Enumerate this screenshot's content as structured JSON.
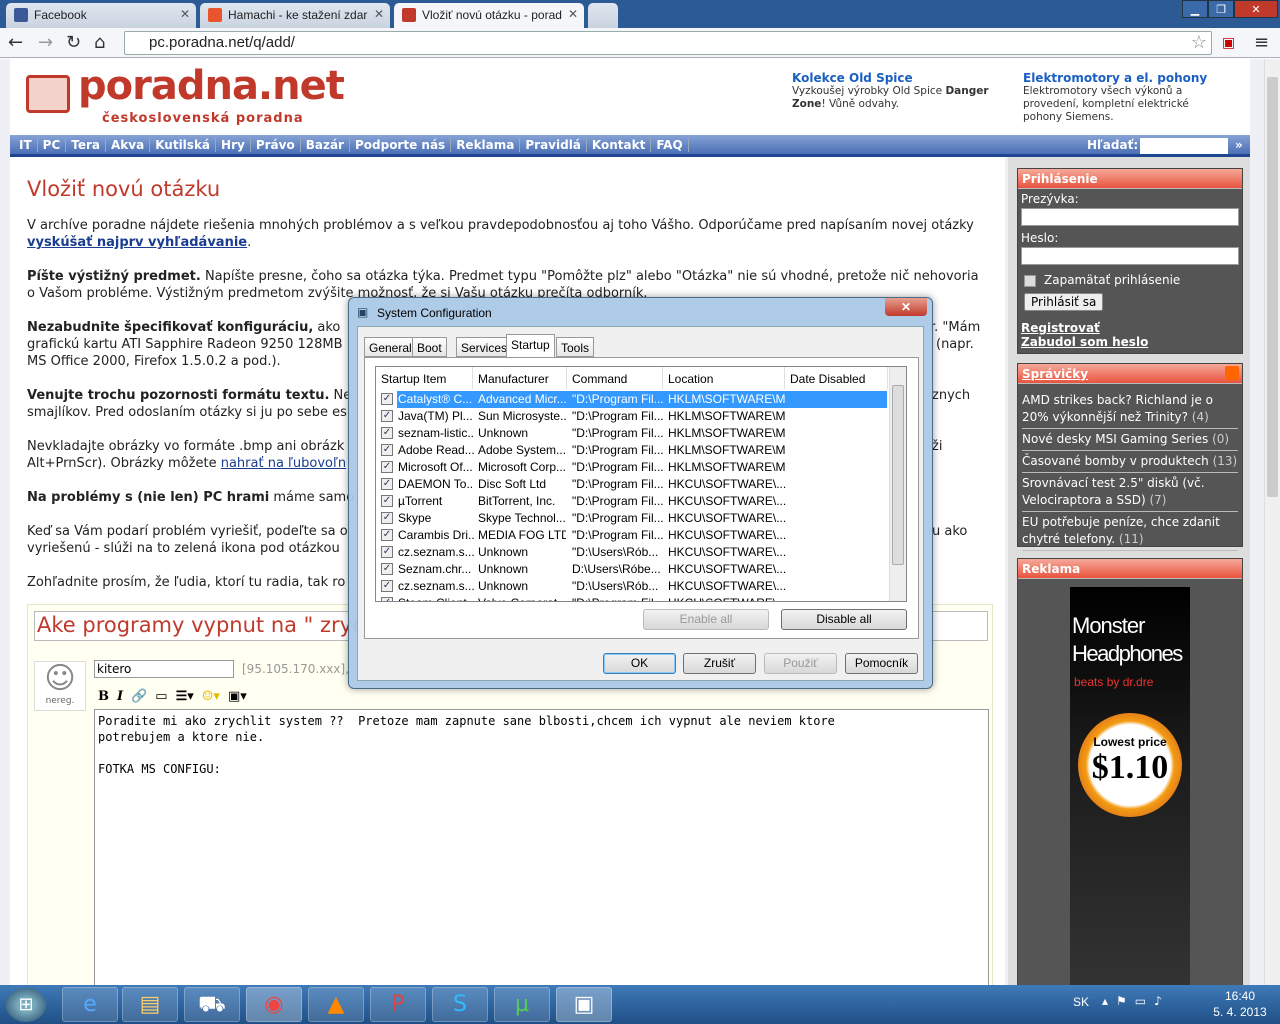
{
  "browser": {
    "tabs": [
      {
        "title": "Facebook",
        "color": "#3b5998"
      },
      {
        "title": "Hamachi - ke stažení zdar",
        "color": "#e8542c"
      },
      {
        "title": "Vložiť novú otázku - porad",
        "color": "#c0392b"
      }
    ],
    "url": "pc.poradna.net/q/add/",
    "window": {
      "minimize": "▁",
      "maximize": "❐",
      "close": "✕"
    }
  },
  "header": {
    "logo": "poradna.net",
    "tagline": "československá poradna",
    "ads": [
      {
        "title": "Kolekce Old Spice",
        "text1": "Vyzkoušej výrobky Old Spice ",
        "bold1": "Danger Zone",
        "text2": "! Vůně odvahy."
      },
      {
        "title": "Elektromotory a el. pohony",
        "text": "Elektromotory všech výkonů a provedení, kompletní elektrické pohony Siemens."
      }
    ]
  },
  "nav": {
    "items": [
      "IT",
      "PC",
      "Tera",
      "Akva",
      "Kutilská",
      "Hry",
      "Právo",
      "Bazár",
      "Podporte nás",
      "Reklama",
      "Pravidlá",
      "Kontakt",
      "FAQ"
    ],
    "search_label": "Hľadať:",
    "go": "»"
  },
  "main": {
    "title": "Vložiť novú otázku",
    "p1a": "V archíve poradne nájdete riešenia mnohých problémov a s veľkou pravdepodobnosťou aj toho Vášho. Odporúčame pred napísaním novej otázky",
    "p1link": "vyskúšať najprv vyhľadávanie",
    "p1end": ".",
    "p2bold": "Píšte výstižný predmet.",
    "p2a": " Napíšte presne, čoho sa otázka týka. Predmet typu \"Pomôžte plz\" alebo \"Otázka\" nie sú vhodné, pretože nič nehovoria",
    "p2b": "o Vašom probléme. Výstižným predmetom zvýšite možnosť, že si Vašu otázku prečíta odborník.",
    "p3bold": "Nezabudnite špecifikovať konfiguráciu,",
    "p3a": " ako",
    "p3r1": "r. \"Mám",
    "p3b": "grafickú kartu ATI Sapphire Radeon 9250 128MB",
    "p3r2": "(napr.",
    "p3c": "MS Office 2000, Firefox 1.5.0.2 a pod.).",
    "p4bold": "Venujte trochu pozornosti formátu textu.",
    "p4a": " Ne",
    "p4r": "znych",
    "p4b": "smajlíkov. Pred odoslaním otázky si ju po sebe es",
    "p5a": "Nevkladajte obrázky vo formáte .bmp ani obrázk",
    "p5r": "ži",
    "p5b": "Alt+PrnScr). Obrázky môžete ",
    "p5link": "nahrať na ľubovoľn",
    "p6bold": "Na problémy s (nie len) PC hrami",
    "p6a": " máme samo",
    "p7a": "Keď sa Vám podarí problém vyriešiť, podeľte sa o",
    "p7r": "u ako",
    "p7b": "vyriešenú - slúži na to zelená ikona pod otázkou",
    "p8": "Zohľadnite prosím, že ľudia, ktorí tu radia, tak ro"
  },
  "form": {
    "subject": "Ake programy vypnut na \" zrychl",
    "avatar_label": "nereg.",
    "nick": "kitero",
    "ip": "[95.105.170.xxx],",
    "body": "Poradite mi ako zrychlit system ??  Pretoze mam zapnute sane blbosti,chcem ich vypnut ale neviem ktore\npotrebujem a ktore nie.\n\nFOTKA MS CONFIGU:"
  },
  "sidebar": {
    "login": {
      "title": "Prihlásenie",
      "nick_label": "Prezývka:",
      "pass_label": "Heslo:",
      "remember": "Zapamätať prihlásenie",
      "submit": "Prihlásiť sa",
      "register": "Registrovať",
      "forgot": "Zabudol som heslo"
    },
    "news": {
      "title": "Správičky",
      "items": [
        {
          "t": "AMD strikes back? Richland je o 20% výkonnější než Trinity?",
          "c": "(4)"
        },
        {
          "t": "Nové desky MSI Gaming Series",
          "c": "(0)"
        },
        {
          "t": "Časované bomby v produktech",
          "c": "(13)"
        },
        {
          "t": "Srovnávací test 2.5\" disků (vč. Velociraptora a SSD)",
          "c": "(7)"
        },
        {
          "t": "EU potřebuje peníze, chce zdanit chytré telefony.",
          "c": "(11)"
        }
      ]
    },
    "ad": {
      "title": "Reklama",
      "line1": "Monster",
      "line2": "Headphones",
      "brand": "beats by dr.dre",
      "price_label": "Lowest price",
      "price": "$1.10"
    }
  },
  "dialog": {
    "title": "System Configuration",
    "tabs": [
      "General",
      "Boot",
      "Services",
      "Startup",
      "Tools"
    ],
    "active_tab": "Startup",
    "columns": [
      "Startup Item",
      "Manufacturer",
      "Command",
      "Location",
      "Date Disabled"
    ],
    "rows": [
      [
        "Catalyst® C...",
        "Advanced Micr...",
        "\"D:\\Program Fil...",
        "HKLM\\SOFTWARE\\M..."
      ],
      [
        "Java(TM) Pl...",
        "Sun Microsyste...",
        "\"D:\\Program Fil...",
        "HKLM\\SOFTWARE\\M..."
      ],
      [
        "seznam-listic...",
        "Unknown",
        "\"D:\\Program Fil...",
        "HKLM\\SOFTWARE\\M..."
      ],
      [
        "Adobe Read...",
        "Adobe System...",
        "\"D:\\Program Fil...",
        "HKLM\\SOFTWARE\\M..."
      ],
      [
        "Microsoft Of...",
        "Microsoft Corp...",
        "\"D:\\Program Fil...",
        "HKLM\\SOFTWARE\\M..."
      ],
      [
        "DAEMON To...",
        "Disc Soft Ltd",
        "\"D:\\Program Fil...",
        "HKCU\\SOFTWARE\\..."
      ],
      [
        "µTorrent",
        "BitTorrent, Inc.",
        "\"D:\\Program Fil...",
        "HKCU\\SOFTWARE\\..."
      ],
      [
        "Skype",
        "Skype Technol...",
        "\"D:\\Program Fil...",
        "HKCU\\SOFTWARE\\..."
      ],
      [
        "Carambis Dri...",
        "MEDIA FOG LTD.",
        "\"D:\\Program Fil...",
        "HKCU\\SOFTWARE\\..."
      ],
      [
        "cz.seznam.s...",
        "Unknown",
        "\"D:\\Users\\Rób...",
        "HKCU\\SOFTWARE\\..."
      ],
      [
        "Seznam.chr...",
        "Unknown",
        "D:\\Users\\Róbe...",
        "HKCU\\SOFTWARE\\..."
      ],
      [
        "cz.seznam.s...",
        "Unknown",
        "\"D:\\Users\\Rób...",
        "HKCU\\SOFTWARE\\..."
      ],
      [
        "Steam Client...",
        "Valve Corporat...",
        "\"D:\\Program Fil...",
        "HKCU\\SOFTWARE\\..."
      ]
    ],
    "enable_all": "Enable all",
    "disable_all": "Disable all",
    "ok": "OK",
    "cancel": "Zrušiť",
    "apply": "Použiť",
    "help": "Pomocník"
  },
  "taskbar": {
    "lang": "SK",
    "time": "16:40",
    "date": "5. 4. 2013"
  }
}
